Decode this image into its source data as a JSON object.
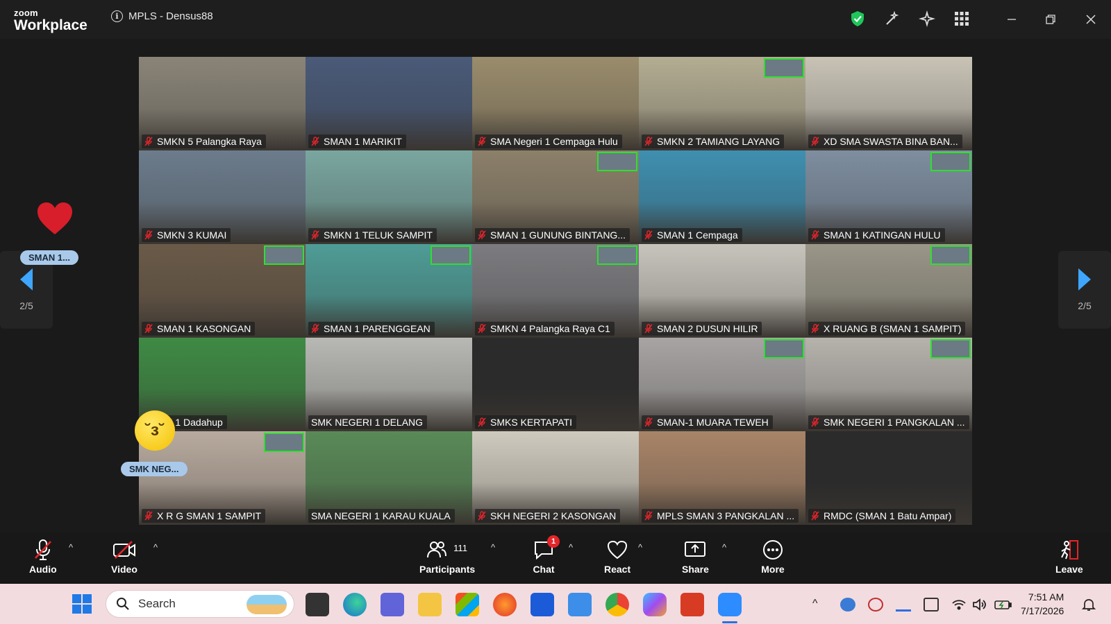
{
  "titlebar": {
    "logo_line1": "zoom",
    "logo_line2": "Workplace",
    "meeting_title": "MPLS - Densus88"
  },
  "gallery": {
    "page_left": "2/5",
    "page_right": "2/5",
    "floating_name_1": "SMAN 1...",
    "floating_name_2": "SMK NEG...",
    "tiles": [
      {
        "name": "SMKN 5 Palangka Raya",
        "muted": true,
        "pip": false,
        "tone": "#8a8478"
      },
      {
        "name": "SMAN 1 MARIKIT",
        "muted": true,
        "pip": false,
        "tone": "#4a5a78"
      },
      {
        "name": "SMA Negeri 1 Cempaga Hulu",
        "muted": true,
        "pip": false,
        "tone": "#9a8c6c"
      },
      {
        "name": "SMKN 2 TAMIANG LAYANG",
        "muted": true,
        "pip": true,
        "tone": "#b3ad92"
      },
      {
        "name": "XD SMA SWASTA BINA BAN...",
        "muted": true,
        "pip": false,
        "tone": "#c9c3b6"
      },
      {
        "name": "SMKN 3 KUMAI",
        "muted": true,
        "pip": false,
        "tone": "#6c7c8c"
      },
      {
        "name": "SMKN 1 TELUK SAMPIT",
        "muted": true,
        "pip": false,
        "tone": "#7aa6a0"
      },
      {
        "name": "SMAN 1 GUNUNG BINTANG...",
        "muted": true,
        "pip": true,
        "tone": "#8c806a"
      },
      {
        "name": "SMAN 1 Cempaga",
        "muted": true,
        "pip": false,
        "tone": "#3f8fb0"
      },
      {
        "name": "SMAN 1 KATINGAN HULU",
        "muted": true,
        "pip": true,
        "tone": "#7e8ea0"
      },
      {
        "name": "SMAN 1 KASONGAN",
        "muted": true,
        "pip": true,
        "tone": "#6a5a48"
      },
      {
        "name": "SMAN 1 PARENGGEAN",
        "muted": true,
        "pip": true,
        "tone": "#4f9c96"
      },
      {
        "name": "SMKN 4 Palangka Raya C1",
        "muted": true,
        "pip": true,
        "tone": "#7c7c80"
      },
      {
        "name": "SMAN 2 DUSUN HILIR",
        "muted": true,
        "pip": false,
        "tone": "#c7c4bc"
      },
      {
        "name": "X RUANG B (SMAN 1 SAMPIT)",
        "muted": true,
        "pip": true,
        "tone": "#9a9688"
      },
      {
        "name": "SMAN 1 Dadahup",
        "muted": false,
        "pip": false,
        "tone": "#3f8a44"
      },
      {
        "name": "SMK NEGERI 1 DELANG",
        "muted": false,
        "pip": false,
        "tone": "#b8b8b4"
      },
      {
        "name": "SMKS KERTAPATI",
        "muted": true,
        "pip": false,
        "tone": "#2b2b2b"
      },
      {
        "name": "SMAN-1 MUARA TEWEH",
        "muted": true,
        "pip": true,
        "tone": "#a8a4a4"
      },
      {
        "name": "SMK NEGERI 1 PANGKALAN ...",
        "muted": true,
        "pip": true,
        "tone": "#b6b2ac"
      },
      {
        "name": "X R G SMAN 1 SAMPIT",
        "muted": true,
        "pip": true,
        "tone": "#b8aa9e"
      },
      {
        "name": "SMA NEGERI 1 KARAU KUALA",
        "muted": false,
        "pip": false,
        "tone": "#5a8a58"
      },
      {
        "name": "SKH NEGERI 2 KASONGAN",
        "muted": true,
        "pip": false,
        "tone": "#cfcabe"
      },
      {
        "name": "MPLS SMAN 3 PANGKALAN ...",
        "muted": true,
        "pip": false,
        "tone": "#a88468"
      },
      {
        "name": "RMDC (SMAN 1 Batu Ampar)",
        "muted": true,
        "pip": false,
        "tone": "#2b2b2b"
      }
    ]
  },
  "toolbar": {
    "audio_label": "Audio",
    "video_label": "Video",
    "participants_label": "Participants",
    "participants_count": "111",
    "chat_label": "Chat",
    "chat_badge": "1",
    "react_label": "React",
    "share_label": "Share",
    "more_label": "More",
    "leave_label": "Leave"
  },
  "taskbar": {
    "search_placeholder": "Search",
    "time": "7:51 AM",
    "date": "7/17/2026"
  },
  "colors": {
    "accent_blue": "#2d8cff",
    "pip_green": "#2fe02f",
    "mute_red": "#e5252a",
    "taskbar_bg": "#f3dcdf"
  }
}
